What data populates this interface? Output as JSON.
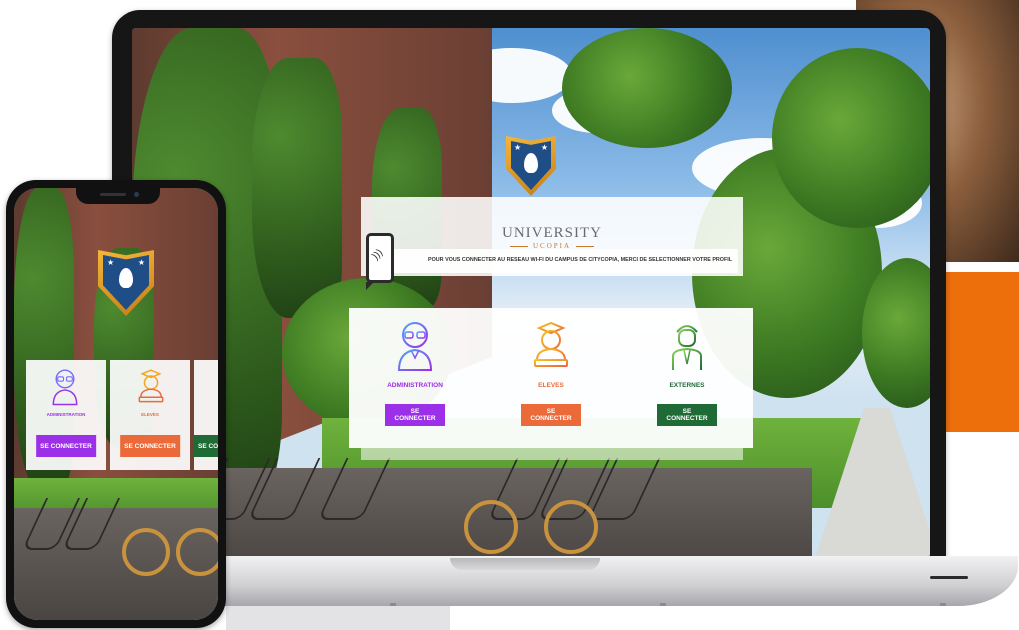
{
  "brand": {
    "title": "UNIVERSITY",
    "subtitle": "UCOPIA"
  },
  "message": "POUR VOUS CONNECTER AU RESEAU WI-FI DU CAMPUS DE CITYCOPIA, MERCI DE SELECTIONNER VOTRE PROFIL",
  "profiles": [
    {
      "label": "ADMINISTRATION",
      "button": "SE CONNECTER",
      "color": "#9b30e8",
      "icon": "admin-avatar-icon"
    },
    {
      "label": "ELEVES",
      "button": "SE CONNECTER",
      "color": "#ec6a3a",
      "icon": "student-avatar-icon"
    },
    {
      "label": "EXTERNES",
      "button": "SE CONNECTER",
      "color": "#1f6b35",
      "icon": "external-avatar-icon"
    }
  ],
  "colors": {
    "accent_orange": "#ec6f0c",
    "shield_blue": "#1f4d86",
    "shield_gold": "#f4b63a"
  }
}
